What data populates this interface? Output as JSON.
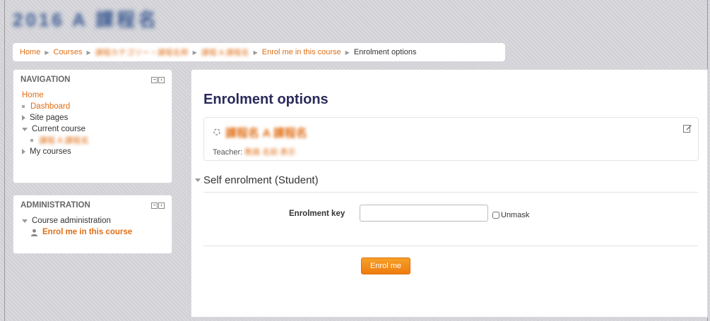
{
  "site": {
    "title": "2016 A 課程名"
  },
  "breadcrumb": {
    "home": "Home",
    "courses": "Courses",
    "category": "課程カテゴリー・課程名称",
    "course": "課程 A 課程名",
    "enrol": "Enrol me in this course",
    "current": "Enrolment options"
  },
  "navigation": {
    "title": "NAVIGATION",
    "home": "Home",
    "dashboard": "Dashboard",
    "site_pages": "Site pages",
    "current_course": "Current course",
    "course_short": "課程 A 課程名",
    "my_courses": "My courses"
  },
  "administration": {
    "title": "ADMINISTRATION",
    "course_admin": "Course administration",
    "enrol_me": "Enrol me in this course"
  },
  "main": {
    "heading": "Enrolment options",
    "course_name": "課程名 A 課程名",
    "teacher_label": "Teacher:",
    "teacher_value": "教員 名前 表示",
    "section_title": "Self enrolment (Student)",
    "key_label": "Enrolment key",
    "key_value": "",
    "unmask_label": "Unmask",
    "submit_label": "Enrol me"
  },
  "colors": {
    "accent": "#e06e15",
    "button": "#f39018",
    "heading": "#2a2a5a"
  }
}
